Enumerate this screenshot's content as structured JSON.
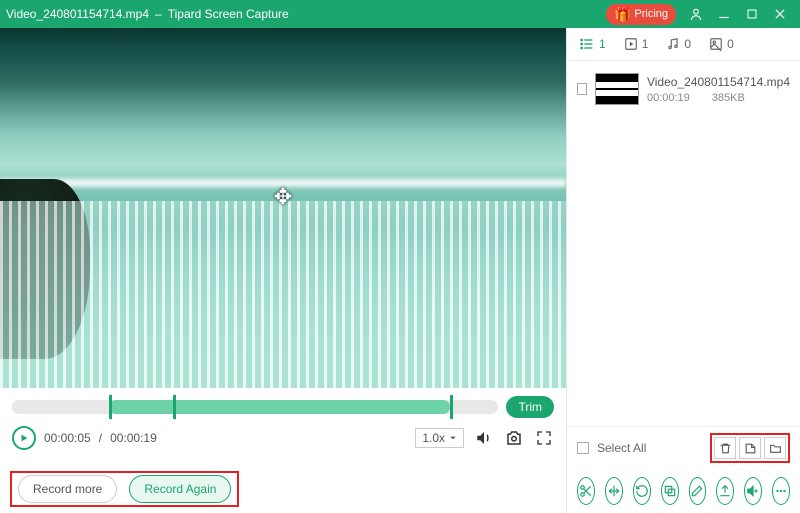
{
  "titlebar": {
    "filename": "Video_240801154714.mp4",
    "separator": "–",
    "appname": "Tipard Screen Capture",
    "pricing_label": "Pricing"
  },
  "trim": {
    "button": "Trim"
  },
  "playback": {
    "current": "00:00:05",
    "total": "00:00:19",
    "speed": "1.0x"
  },
  "record": {
    "more": "Record more",
    "again": "Record Again"
  },
  "tabs": {
    "list_count": "1",
    "video_count": "1",
    "audio_count": "0",
    "image_count": "0"
  },
  "file": {
    "name": "Video_240801154714.mp4",
    "duration": "00:00:19",
    "size": "385KB"
  },
  "select_all": "Select All"
}
